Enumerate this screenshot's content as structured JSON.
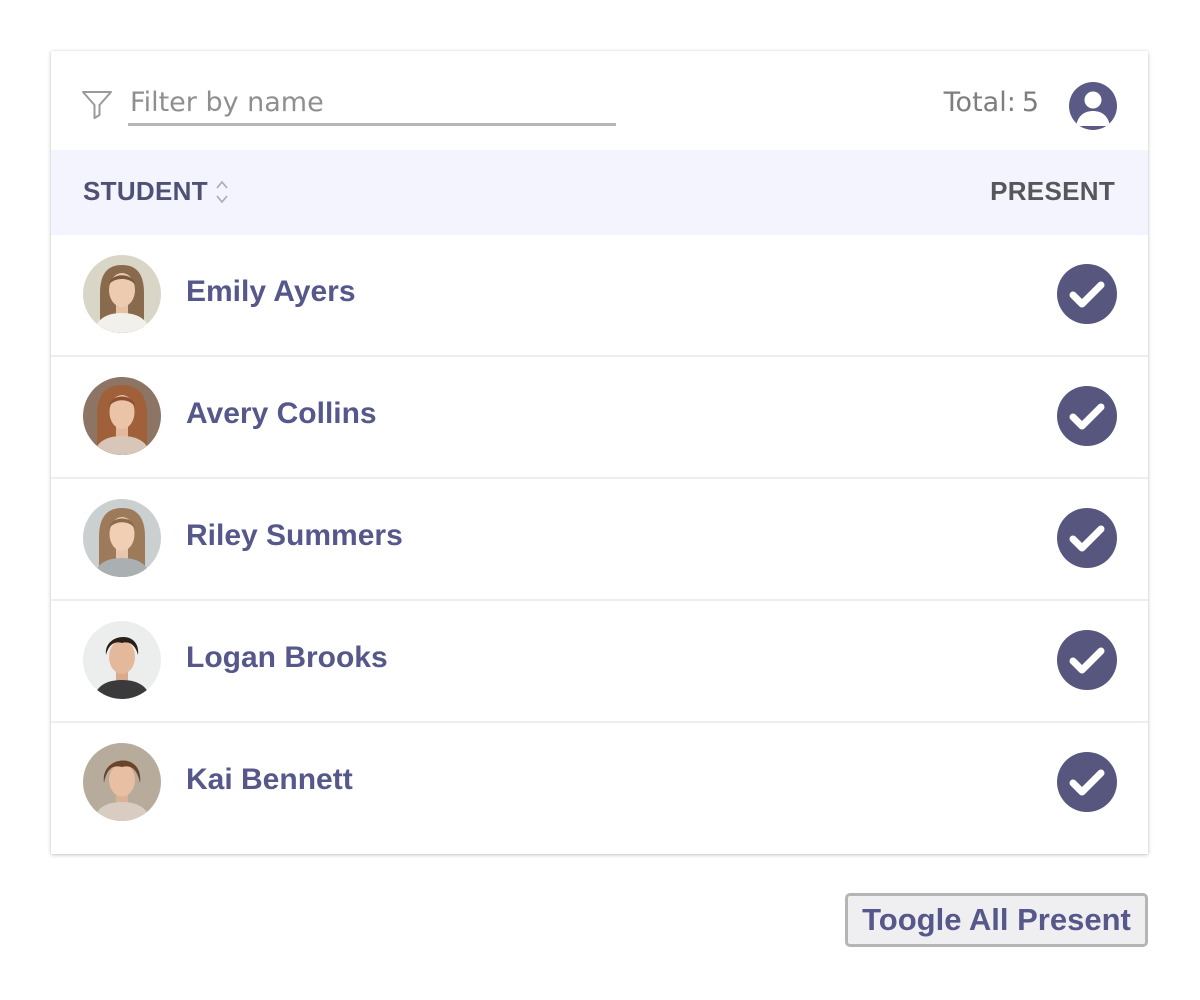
{
  "toolbar": {
    "filter_placeholder": "Filter by name",
    "filter_value": "",
    "total_label": "Total:",
    "total_count": "5"
  },
  "table": {
    "columns": {
      "student": "STUDENT",
      "present": "PRESENT"
    },
    "rows": [
      {
        "name": "Emily Ayers",
        "present": true
      },
      {
        "name": "Avery Collins",
        "present": true
      },
      {
        "name": "Riley Summers",
        "present": true
      },
      {
        "name": "Logan Brooks",
        "present": true
      },
      {
        "name": "Kai Bennett",
        "present": true
      }
    ]
  },
  "actions": {
    "toggle_all_label": "Toogle All Present"
  },
  "icons": {
    "filter": "filter-icon",
    "user": "user-icon",
    "sort": "sort-icon",
    "check": "check-icon"
  },
  "colors": {
    "accent": "#56567f",
    "text_primary": "#56578a",
    "header_bg": "#f3f4fd",
    "muted": "#7e7e7e"
  }
}
